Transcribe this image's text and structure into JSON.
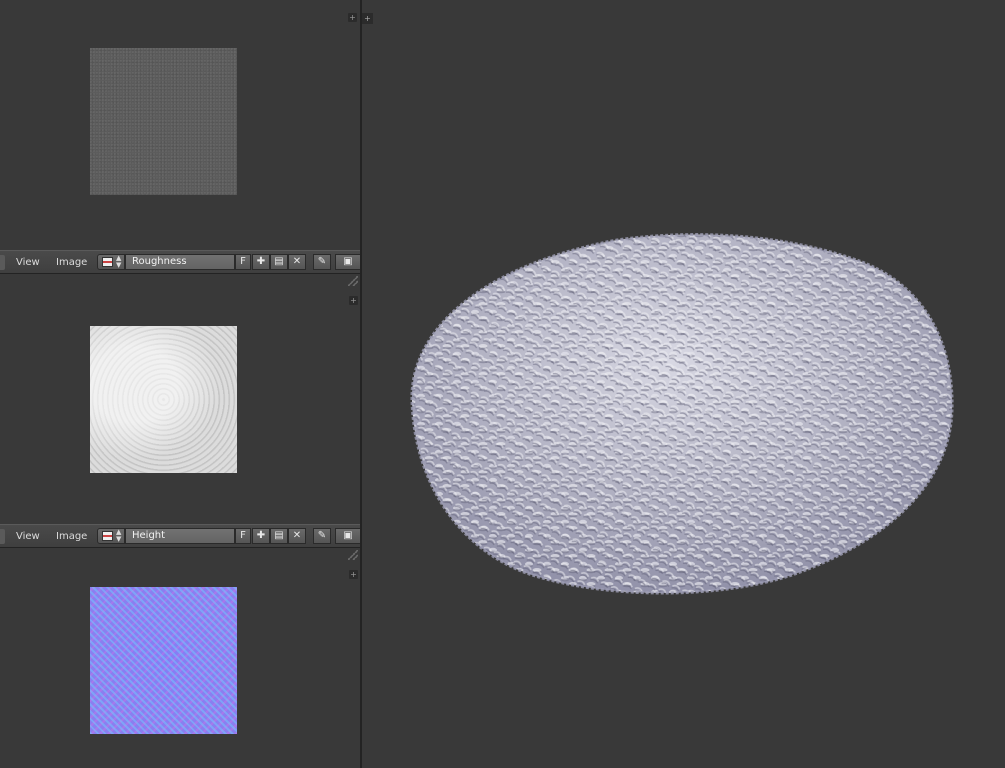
{
  "editors": [
    {
      "menu_view": "View",
      "menu_image": "Image",
      "image_name": "Roughness",
      "fake_user": "F",
      "new_icon": "plus-icon",
      "open_icon": "folder-icon",
      "unlink_icon": "close-icon",
      "pin_icon": "pin-icon"
    },
    {
      "menu_view": "View",
      "menu_image": "Image",
      "image_name": "Height",
      "fake_user": "F",
      "new_icon": "plus-icon",
      "open_icon": "folder-icon",
      "unlink_icon": "close-icon",
      "pin_icon": "pin-icon"
    }
  ],
  "viewport": {
    "object": "displaced-sphere",
    "material_color": "#c9c9d6"
  },
  "colors": {
    "background": "#393939",
    "header": "#444444",
    "field": "#6c6c6c"
  }
}
